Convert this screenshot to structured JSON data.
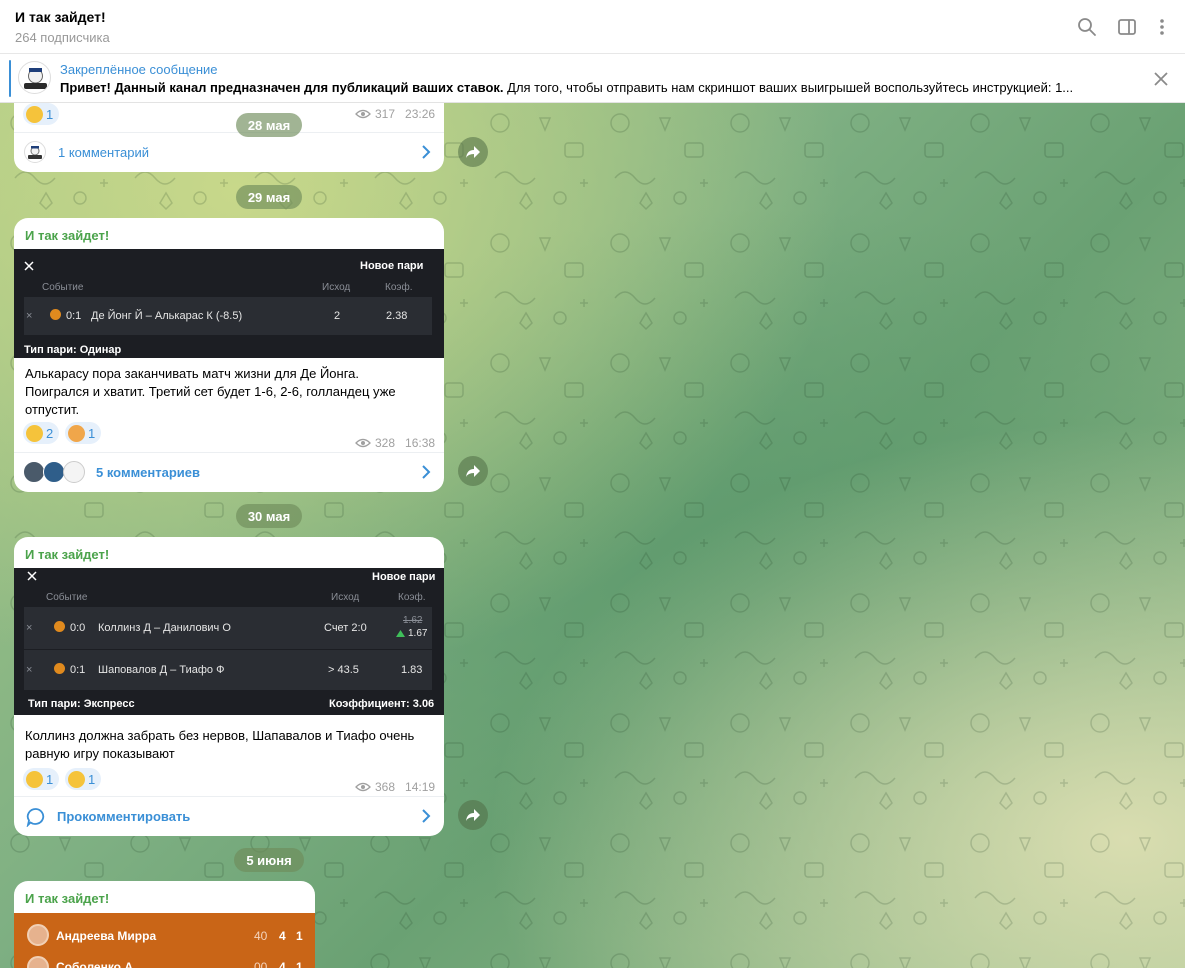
{
  "header": {
    "title": "И так зайдет!",
    "subtitle": "264 подписчика",
    "icons": [
      "search-icon",
      "sidebar-icon",
      "more-icon"
    ]
  },
  "pinned": {
    "title": "Закреплённое сообщение",
    "text_bold": "Привет! Данный канал предназначен для публикаций ваших ставок.",
    "text_rest": "  Для того, чтобы отправить нам скриншот ваших выигрышей воспользуйтесь инструкцией:  1..."
  },
  "colors": {
    "accent": "#3a8fd6",
    "author": "#4ba34b",
    "score_bg": "#c96517"
  },
  "dates": [
    "28 мая",
    "29 мая",
    "30 мая",
    "5 июня"
  ],
  "post0": {
    "reaction_count": "1",
    "views": "317",
    "time": "23:26",
    "comments_label": "1 комментарий"
  },
  "post1": {
    "author": "И так зайдет!",
    "bet": {
      "title": "Новое пари",
      "col_event": "Событие",
      "col_outcome": "Исход",
      "col_coef": "Коэф.",
      "score": "0:1",
      "event": "Де Йонг Й – Алькарас К (-8.5)",
      "outcome": "2",
      "coef": "2.38",
      "type": "Тип пари: Одинар"
    },
    "text_lines": [
      "Алькарасу пора заканчивать матч жизни для Де Йонга.",
      "Поигрался и хватит. Третий сет будет 1-6, 2-6, голландец уже",
      "отпустит."
    ],
    "reactions": [
      {
        "count": "2"
      },
      {
        "count": "1"
      }
    ],
    "views": "328",
    "time": "16:38",
    "comments_label": "5 комментариев"
  },
  "post2": {
    "author": "И так зайдет!",
    "bet": {
      "title": "Новое пари",
      "col_event": "Событие",
      "col_outcome": "Исход",
      "col_coef": "Коэф.",
      "rows": [
        {
          "score": "0:0",
          "event": "Коллинз Д – Данилович О",
          "outcome": "Счет 2:0",
          "coef_old": "1.62",
          "coef": "1.67"
        },
        {
          "score": "0:1",
          "event": "Шаповалов Д – Тиафо Ф",
          "outcome": "> 43.5",
          "coef": "1.83"
        }
      ],
      "type": "Тип пари: Экспресс",
      "total": "Коэффициент: 3.06"
    },
    "text_lines": [
      "Коллинз должна забрать без нервов, Шапавалов и Тиафо очень",
      "равную игру показывают"
    ],
    "reactions": [
      {
        "count": "1"
      },
      {
        "count": "1"
      }
    ],
    "views": "368",
    "time": "14:19",
    "comments_label": "Прокомментировать"
  },
  "post3": {
    "author": "И так зайдет!",
    "players": [
      {
        "name": "Андреева Мирра",
        "s1": "40",
        "s2": "4",
        "s3": "1"
      },
      {
        "name": "Соболенко А",
        "s1": "00",
        "s2": "4",
        "s3": "1"
      }
    ]
  }
}
